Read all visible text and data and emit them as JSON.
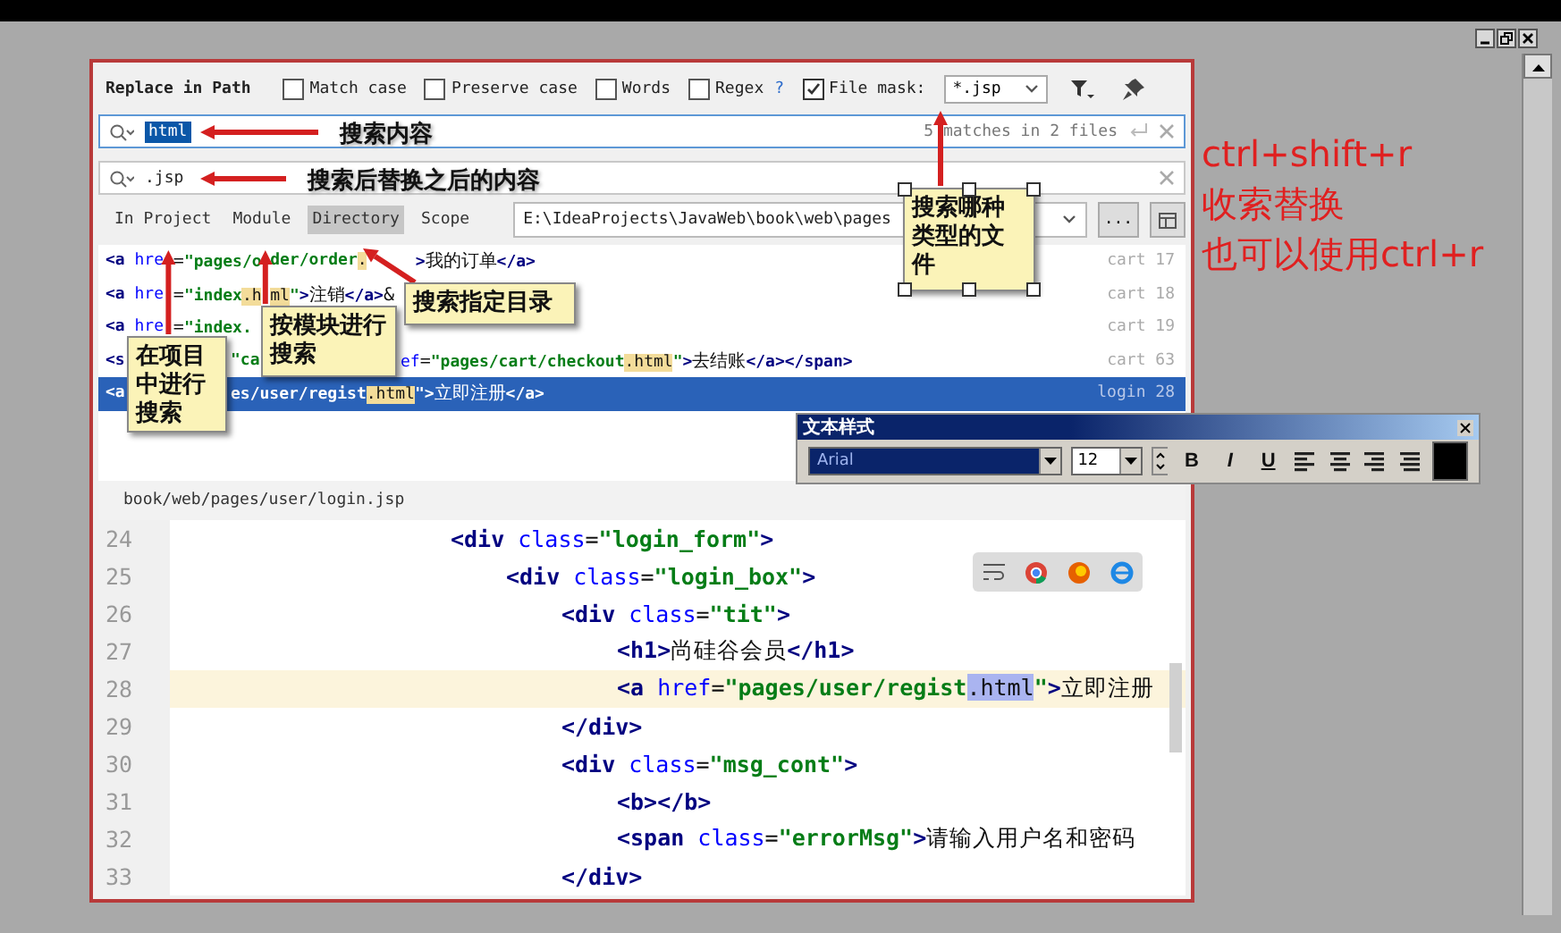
{
  "dialog": {
    "title": "Replace in Path",
    "options": [
      {
        "label": "Match case",
        "checked": false
      },
      {
        "label": "Preserve case",
        "checked": false
      },
      {
        "label": "Words",
        "checked": false
      },
      {
        "label": "Regex",
        "checked": false,
        "help": "?"
      }
    ],
    "file_mask": {
      "label": "File mask:",
      "checked": true,
      "value": "*.jsp"
    },
    "search": {
      "value": "html",
      "status": "5 matches in 2 files"
    },
    "replace": {
      "value": ".jsp"
    },
    "scopes": [
      {
        "label": "In Project",
        "selected": false
      },
      {
        "label": "Module",
        "selected": false
      },
      {
        "label": "Directory",
        "selected": true
      },
      {
        "label": "Scope",
        "selected": false
      }
    ],
    "directory": {
      "value": "E:\\IdeaProjects\\JavaWeb\\book\\web\\pages"
    },
    "browse_button": "...",
    "results": [
      {
        "selected": false,
        "file": "cart 17",
        "segments": [
          [
            {
              "kind": "tag",
              "text": "<a "
            },
            {
              "kind": "attr",
              "text": "hre"
            }
          ],
          [
            {
              "kind": "text",
              "text": "="
            },
            {
              "kind": "str",
              "text": "\"pages/o"
            }
          ],
          [
            {
              "kind": "str",
              "text": "der/order"
            },
            {
              "kind": "match",
              "text": "."
            }
          ],
          [
            {
              "kind": "tag",
              "text": ">"
            },
            {
              "kind": "text",
              "text": "我的订单"
            },
            {
              "kind": "tag",
              "text": "</a>"
            }
          ]
        ]
      },
      {
        "selected": false,
        "file": "cart 18",
        "segments": [
          [
            {
              "kind": "tag",
              "text": "<a "
            },
            {
              "kind": "attr",
              "text": "hre"
            }
          ],
          [
            {
              "kind": "text",
              "text": "="
            },
            {
              "kind": "str",
              "text": "\"index"
            },
            {
              "kind": "match",
              "text": ".h"
            }
          ],
          [
            {
              "kind": "match",
              "text": "ml"
            },
            {
              "kind": "str",
              "text": "\""
            },
            {
              "kind": "tag",
              "text": ">"
            },
            {
              "kind": "text",
              "text": "注销"
            },
            {
              "kind": "tag",
              "text": "</a>"
            },
            {
              "kind": "text",
              "text": "&"
            }
          ]
        ]
      },
      {
        "selected": false,
        "file": "cart 19",
        "segments": [
          [
            {
              "kind": "tag",
              "text": "<a "
            },
            {
              "kind": "attr",
              "text": "hre"
            }
          ],
          [
            {
              "kind": "text",
              "text": "="
            },
            {
              "kind": "str",
              "text": "\"index."
            }
          ]
        ]
      },
      {
        "selected": false,
        "file": "cart 63",
        "segments": [
          [
            {
              "kind": "tag",
              "text": "<s"
            }
          ],
          [
            {
              "kind": "str",
              "text": "\"ca"
            }
          ],
          [
            {
              "kind": "attr",
              "text": "ef"
            },
            {
              "kind": "text",
              "text": "="
            },
            {
              "kind": "str",
              "text": "\"pages/cart/checkout"
            },
            {
              "kind": "match",
              "text": ".html"
            },
            {
              "kind": "str",
              "text": "\""
            },
            {
              "kind": "tag",
              "text": ">"
            },
            {
              "kind": "text",
              "text": "去结账"
            },
            {
              "kind": "tag",
              "text": "</a></span>"
            }
          ]
        ]
      },
      {
        "selected": true,
        "file": "login 28",
        "segments": [
          [
            {
              "kind": "tag",
              "text": "<a"
            }
          ],
          [
            {
              "kind": "str",
              "text": "es/user/regist"
            },
            {
              "kind": "match",
              "text": ".html"
            },
            {
              "kind": "str",
              "text": "\""
            },
            {
              "kind": "tag",
              "text": ">"
            },
            {
              "kind": "text",
              "text": "立即注册"
            },
            {
              "kind": "tag",
              "text": "</a>"
            }
          ]
        ]
      }
    ],
    "editor": {
      "path": "book/web/pages/user/login.jsp",
      "lines": [
        {
          "number": "24",
          "current": false,
          "tokens": [
            {
              "kind": "tag",
              "text": "<div"
            },
            {
              "kind": "attr",
              "text": " class"
            },
            {
              "kind": "text",
              "text": "="
            },
            {
              "kind": "str",
              "text": "\"login_form\""
            },
            {
              "kind": "tag",
              "text": ">"
            }
          ]
        },
        {
          "number": "25",
          "current": false,
          "tokens": [
            {
              "kind": "tag",
              "text": "<div"
            },
            {
              "kind": "attr",
              "text": " class"
            },
            {
              "kind": "text",
              "text": "="
            },
            {
              "kind": "str",
              "text": "\"login_box\""
            },
            {
              "kind": "tag",
              "text": ">"
            }
          ]
        },
        {
          "number": "26",
          "current": false,
          "tokens": [
            {
              "kind": "tag",
              "text": "<div"
            },
            {
              "kind": "attr",
              "text": " class"
            },
            {
              "kind": "text",
              "text": "="
            },
            {
              "kind": "str",
              "text": "\"tit\""
            },
            {
              "kind": "tag",
              "text": ">"
            }
          ]
        },
        {
          "number": "27",
          "current": false,
          "tokens": [
            {
              "kind": "tag",
              "text": "<h1>"
            },
            {
              "kind": "text",
              "text": "尚硅谷会员"
            },
            {
              "kind": "tag",
              "text": "</h1>"
            }
          ]
        },
        {
          "number": "28",
          "current": true,
          "tokens": [
            {
              "kind": "tag",
              "text": "<a"
            },
            {
              "kind": "attr",
              "text": " href"
            },
            {
              "kind": "text",
              "text": "="
            },
            {
              "kind": "str",
              "text": "\"pages/user/regist"
            },
            {
              "kind": "match",
              "text": ".html"
            },
            {
              "kind": "str",
              "text": "\""
            },
            {
              "kind": "tag",
              "text": ">"
            },
            {
              "kind": "text",
              "text": "立即注册"
            }
          ]
        },
        {
          "number": "29",
          "current": false,
          "tokens": [
            {
              "kind": "tag",
              "text": "</div>"
            }
          ]
        },
        {
          "number": "30",
          "current": false,
          "tokens": [
            {
              "kind": "tag",
              "text": "<div"
            },
            {
              "kind": "attr",
              "text": " class"
            },
            {
              "kind": "text",
              "text": "="
            },
            {
              "kind": "str",
              "text": "\"msg_cont\""
            },
            {
              "kind": "tag",
              "text": ">"
            }
          ]
        },
        {
          "number": "31",
          "current": false,
          "tokens": [
            {
              "kind": "tag",
              "text": "<b></b>"
            }
          ]
        },
        {
          "number": "32",
          "current": false,
          "tokens": [
            {
              "kind": "tag",
              "text": "<span"
            },
            {
              "kind": "attr",
              "text": " class"
            },
            {
              "kind": "text",
              "text": "="
            },
            {
              "kind": "str",
              "text": "\"errorMsg\""
            },
            {
              "kind": "tag",
              "text": ">"
            },
            {
              "kind": "text",
              "text": "请输入用户名和密码"
            }
          ]
        },
        {
          "number": "33",
          "current": false,
          "tokens": [
            {
              "kind": "tag",
              "text": "</div>"
            }
          ]
        }
      ]
    }
  },
  "annotations": {
    "notes": [
      "搜索内容",
      "搜索后替换之后的内容"
    ],
    "callouts": [
      {
        "text": "在项目中进行搜索",
        "selected": false
      },
      {
        "text": "按模块进行搜索",
        "selected": false
      },
      {
        "text": "搜索指定目录",
        "selected": false
      },
      {
        "text": "搜索哪种类型的文件",
        "selected": true
      }
    ],
    "shortcut_note": [
      "ctrl+shift+r",
      "收索替换",
      "也可以使用ctrl+r"
    ]
  },
  "text_style_toolbar": {
    "title": "文本样式",
    "font": "Arial",
    "size": "12",
    "format_buttons": [
      "B",
      "I",
      "U"
    ]
  }
}
